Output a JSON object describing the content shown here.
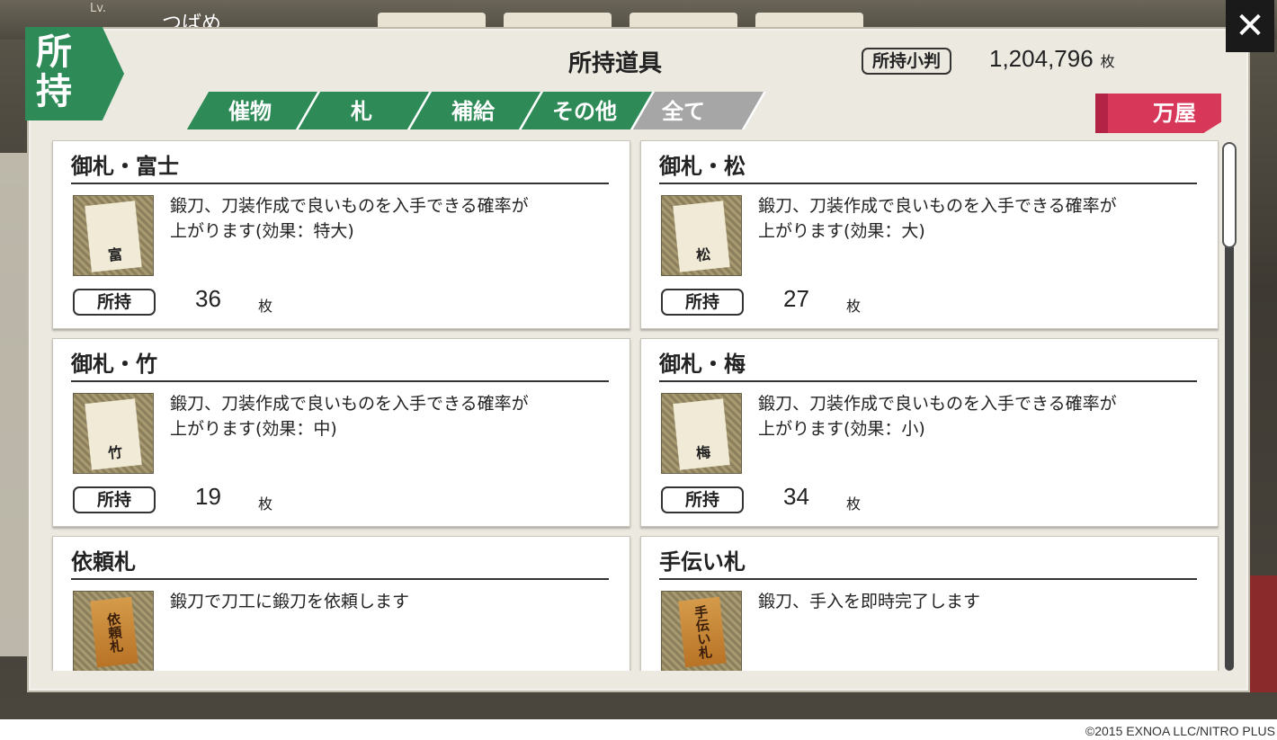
{
  "background": {
    "level_label": "Lv.",
    "player_name": "つばめ"
  },
  "modal": {
    "corner_label": "所持",
    "title": "所持道具",
    "koban_label": "所持小判",
    "koban_value": "1,204,796",
    "koban_unit": "枚",
    "close_label": "✕",
    "shop_label": "万屋"
  },
  "tabs": [
    {
      "label": "催物",
      "active": true
    },
    {
      "label": "札",
      "active": true
    },
    {
      "label": "補給",
      "active": true
    },
    {
      "label": "その他",
      "active": true
    },
    {
      "label": "全て",
      "active": false
    }
  ],
  "items": [
    {
      "name": "御札・富士",
      "desc_line1": "鍛刀、刀装作成で良いものを入手できる確率が",
      "desc_line2": "上がります(効果：特大)",
      "icon_char": "富",
      "own_label": "所持",
      "count": "36",
      "unit": "枚",
      "icon_type": "paper"
    },
    {
      "name": "御札・松",
      "desc_line1": "鍛刀、刀装作成で良いものを入手できる確率が",
      "desc_line2": "上がります(効果：大)",
      "icon_char": "松",
      "own_label": "所持",
      "count": "27",
      "unit": "枚",
      "icon_type": "paper"
    },
    {
      "name": "御札・竹",
      "desc_line1": "鍛刀、刀装作成で良いものを入手できる確率が",
      "desc_line2": "上がります(効果：中)",
      "icon_char": "竹",
      "own_label": "所持",
      "count": "19",
      "unit": "枚",
      "icon_type": "paper"
    },
    {
      "name": "御札・梅",
      "desc_line1": "鍛刀、刀装作成で良いものを入手できる確率が",
      "desc_line2": "上がります(効果：小)",
      "icon_char": "梅",
      "own_label": "所持",
      "count": "34",
      "unit": "枚",
      "icon_type": "paper"
    },
    {
      "name": "依頼札",
      "desc_line1": "鍛刀で刀工に鍛刀を依頼します",
      "desc_line2": "",
      "icon_char": "依頼札",
      "icon_type": "wood"
    },
    {
      "name": "手伝い札",
      "desc_line1": "鍛刀、手入を即時完了します",
      "desc_line2": "",
      "icon_char": "手伝い札",
      "icon_type": "wood"
    }
  ],
  "copyright": "©2015 EXNOA LLC/NITRO PLUS"
}
